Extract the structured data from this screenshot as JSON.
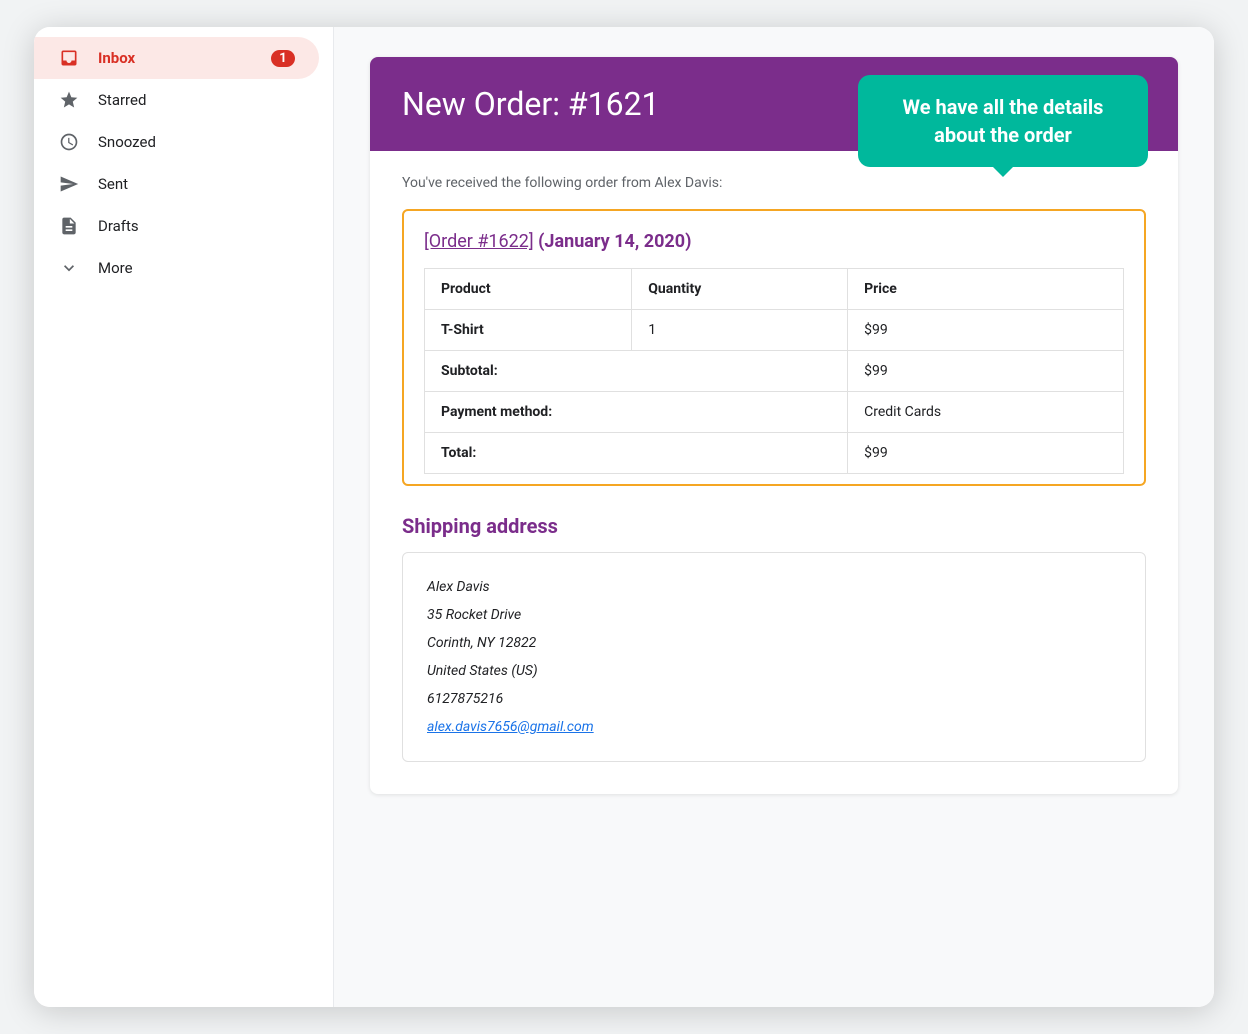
{
  "sidebar": {
    "items": [
      {
        "id": "inbox",
        "label": "Inbox",
        "icon": "inbox",
        "badge": "1",
        "active": true
      },
      {
        "id": "starred",
        "label": "Starred",
        "icon": "star",
        "badge": "",
        "active": false
      },
      {
        "id": "snoozed",
        "label": "Snoozed",
        "icon": "clock",
        "badge": "",
        "active": false
      },
      {
        "id": "sent",
        "label": "Sent",
        "icon": "send",
        "badge": "",
        "active": false
      },
      {
        "id": "drafts",
        "label": "Drafts",
        "icon": "draft",
        "badge": "",
        "active": false
      },
      {
        "id": "more",
        "label": "More",
        "icon": "chevron-down",
        "badge": "",
        "active": false
      }
    ]
  },
  "email": {
    "header": {
      "title": "New Order: #1621"
    },
    "tooltip": {
      "text": "We have all the details about the order"
    },
    "intro": "You've received the following order from Alex Davis:",
    "order": {
      "link_text": "[Order #1622]",
      "date": "(January 14, 2020)",
      "table": {
        "headers": [
          "Product",
          "Quantity",
          "Price"
        ],
        "rows": [
          {
            "product": "T-Shirt",
            "quantity": "1",
            "price": "$99"
          }
        ],
        "subtotal_label": "Subtotal:",
        "subtotal_value": "$99",
        "payment_label": "Payment method:",
        "payment_value": "Credit Cards",
        "total_label": "Total:",
        "total_value": "$99"
      }
    },
    "shipping": {
      "title": "Shipping address",
      "address": {
        "name": "Alex Davis",
        "street": "35 Rocket Drive",
        "city": "Corinth, NY 12822",
        "country": "United States (US)",
        "phone": "6127875216",
        "email": "alex.davis7656@gmail.com"
      }
    }
  }
}
